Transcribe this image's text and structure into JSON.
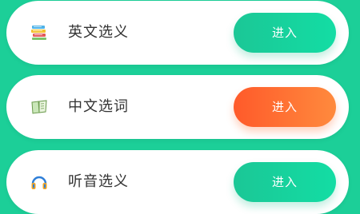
{
  "colors": {
    "background": "#1ccf98",
    "card": "#ffffff",
    "label": "#333333",
    "button_green": "#16d29d",
    "button_orange": "#ff6f33"
  },
  "cards": [
    {
      "label": "英文选义",
      "button": "进入",
      "icon": "books-icon",
      "button_color": "green"
    },
    {
      "label": "中文选词",
      "button": "进入",
      "icon": "open-book-icon",
      "button_color": "orange"
    },
    {
      "label": "听音选义",
      "button": "进入",
      "icon": "headphones-icon",
      "button_color": "green"
    }
  ]
}
